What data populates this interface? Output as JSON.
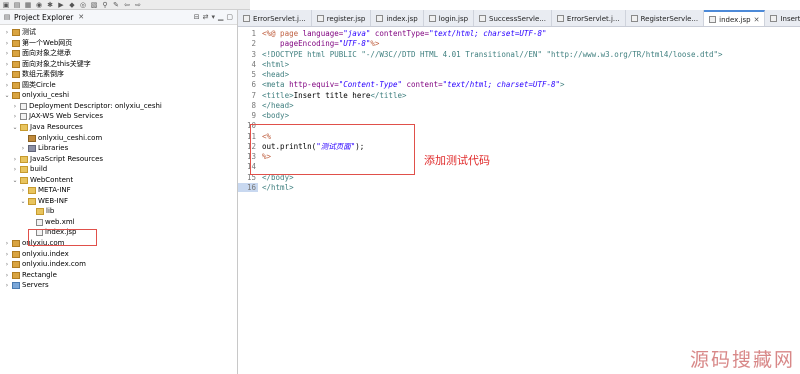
{
  "explorer": {
    "title": "Project Explorer",
    "items": [
      {
        "label": "测试",
        "kind": "prj",
        "open": false
      },
      {
        "label": "第一个Web网页",
        "kind": "prj",
        "open": false
      },
      {
        "label": "面向对象之继承",
        "kind": "prj",
        "open": false
      },
      {
        "label": "面向对象之this关键字",
        "kind": "prj",
        "open": false
      },
      {
        "label": "数组元素倒序",
        "kind": "prj",
        "open": false
      },
      {
        "label": "圆类Circle",
        "kind": "prj",
        "open": false
      },
      {
        "label": "onlyxiu_ceshi",
        "kind": "prj",
        "open": true
      },
      {
        "label": "Deployment Descriptor: onlyxiu_ceshi",
        "kind": "file",
        "open": false
      },
      {
        "label": "JAX-WS Web Services",
        "kind": "file",
        "open": false
      },
      {
        "label": "Java Resources",
        "kind": "fold",
        "open": true
      },
      {
        "label": "onlyxiu_ceshi.com",
        "kind": "pkg",
        "open": null
      },
      {
        "label": "Libraries",
        "kind": "lib",
        "open": false
      },
      {
        "label": "JavaScript Resources",
        "kind": "fold",
        "open": false
      },
      {
        "label": "build",
        "kind": "fold",
        "open": false
      },
      {
        "label": "WebContent",
        "kind": "fold",
        "open": true
      },
      {
        "label": "META-INF",
        "kind": "fold",
        "open": false
      },
      {
        "label": "WEB-INF",
        "kind": "fold",
        "open": true
      },
      {
        "label": "lib",
        "kind": "fold",
        "open": null
      },
      {
        "label": "web.xml",
        "kind": "file",
        "open": null
      },
      {
        "label": "index.jsp",
        "kind": "file",
        "open": null
      },
      {
        "label": "onlyxiu.com",
        "kind": "prj",
        "open": false
      },
      {
        "label": "onlyxiu.index",
        "kind": "prj",
        "open": false
      },
      {
        "label": "onlyxiu.index.com",
        "kind": "prj",
        "open": false
      },
      {
        "label": "Rectangle",
        "kind": "prj",
        "open": false
      },
      {
        "label": "Servers",
        "kind": "srv",
        "open": false
      }
    ]
  },
  "tabs": [
    {
      "label": "ErrorServlet.j...",
      "active": false
    },
    {
      "label": "register.jsp",
      "active": false
    },
    {
      "label": "index.jsp",
      "active": false
    },
    {
      "label": "login.jsp",
      "active": false
    },
    {
      "label": "SuccessServle...",
      "active": false
    },
    {
      "label": "ErrorServlet.j...",
      "active": false
    },
    {
      "label": "RegisterServle...",
      "active": false
    },
    {
      "label": "index.jsp",
      "active": true
    },
    {
      "label": "Insert t",
      "active": false
    }
  ],
  "editor": {
    "line_numbers": [
      "1",
      "2",
      "3",
      "4",
      "5",
      "6",
      "7",
      "8",
      "9",
      "10",
      "11",
      "12",
      "13",
      "14",
      "15",
      "16"
    ],
    "current_line": "16",
    "lines": [
      [
        {
          "t": "<%@ page ",
          "c": "jsp"
        },
        {
          "t": "language=",
          "c": "attr"
        },
        {
          "t": "\"java\"",
          "c": "str"
        },
        {
          "t": " contentType=",
          "c": "attr"
        },
        {
          "t": "\"text/html; charset=UTF-8\"",
          "c": "str"
        }
      ],
      [
        {
          "t": "    pageEncoding=",
          "c": "attr"
        },
        {
          "t": "\"UTF-8\"",
          "c": "str"
        },
        {
          "t": "%>",
          "c": "jsp"
        }
      ],
      [
        {
          "t": "<!DOCTYPE html PUBLIC \"-//W3C//DTD HTML 4.01 Transitional//EN\" \"http://www.w3.org/TR/html4/loose.dtd\">",
          "c": "tag"
        }
      ],
      [
        {
          "t": "<html>",
          "c": "tag"
        }
      ],
      [
        {
          "t": "<head>",
          "c": "tag"
        }
      ],
      [
        {
          "t": "<meta ",
          "c": "tag"
        },
        {
          "t": "http-equiv=",
          "c": "attr"
        },
        {
          "t": "\"Content-Type\"",
          "c": "str"
        },
        {
          "t": " content=",
          "c": "attr"
        },
        {
          "t": "\"text/html; charset=UTF-8\"",
          "c": "str"
        },
        {
          "t": ">",
          "c": "tag"
        }
      ],
      [
        {
          "t": "<title>",
          "c": "tag"
        },
        {
          "t": "Insert title here",
          "c": "plain"
        },
        {
          "t": "</title>",
          "c": "tag"
        }
      ],
      [
        {
          "t": "</head>",
          "c": "tag"
        }
      ],
      [
        {
          "t": "<body>",
          "c": "tag"
        }
      ],
      [],
      [
        {
          "t": "<%",
          "c": "jsp"
        }
      ],
      [
        {
          "t": "out.println(",
          "c": "plain"
        },
        {
          "t": "\"测试页面\"",
          "c": "str"
        },
        {
          "t": ");",
          "c": "plain"
        }
      ],
      [
        {
          "t": "%>",
          "c": "jsp"
        }
      ],
      [],
      [
        {
          "t": "</body>",
          "c": "tag"
        }
      ],
      [
        {
          "t": "</html>",
          "c": "tag"
        }
      ]
    ]
  },
  "annotation": "添加测试代码",
  "watermark": "源码搜藏网"
}
